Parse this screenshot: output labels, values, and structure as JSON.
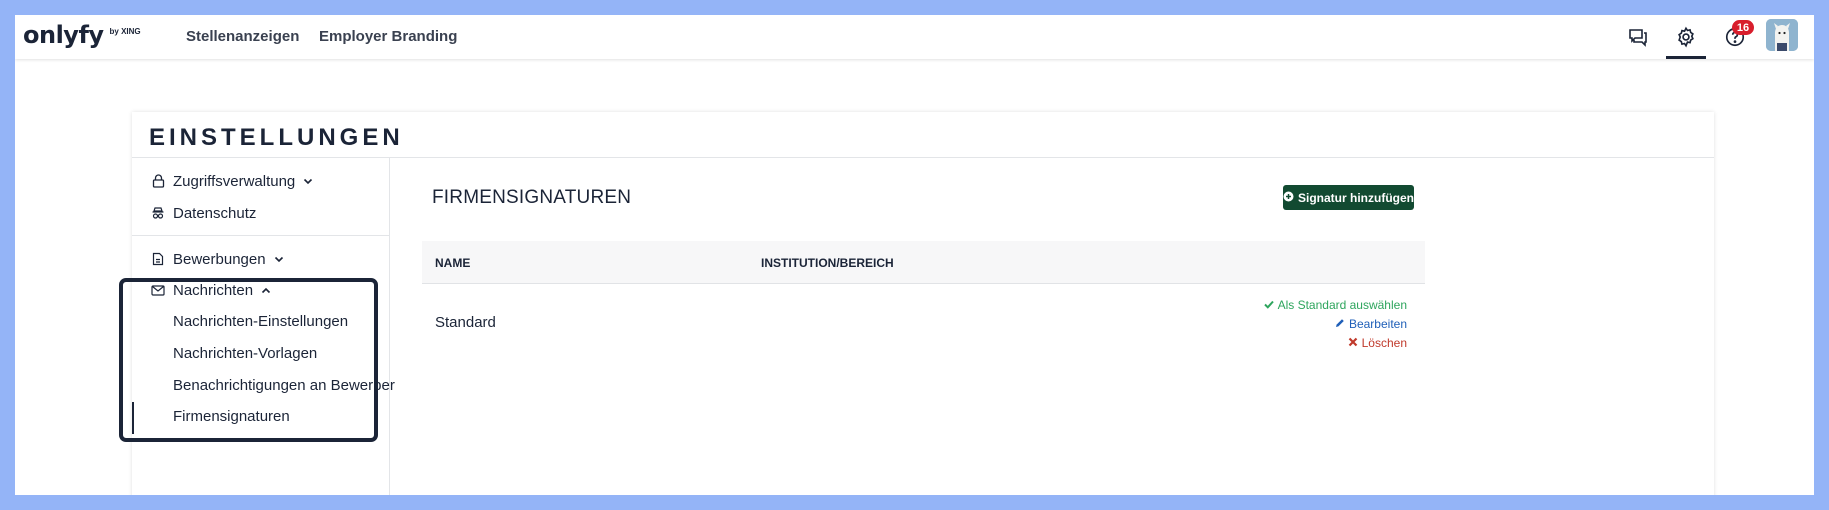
{
  "header": {
    "logo": "onlyfy",
    "logo_suffix": "by XING",
    "nav": [
      "Stellenanzeigen",
      "Employer Branding"
    ],
    "notifications_badge": "16",
    "icons": [
      "chat-icon",
      "gear-icon",
      "help-icon",
      "avatar"
    ]
  },
  "settings": {
    "title": "EINSTELLUNGEN",
    "sidebar": {
      "items": [
        {
          "label": "Zugriffsverwaltung",
          "icon": "lock-icon",
          "expanded": false
        },
        {
          "label": "Datenschutz",
          "icon": "privacy-icon"
        },
        {
          "label": "Bewerbungen",
          "icon": "document-icon",
          "expanded": false
        },
        {
          "label": "Nachrichten",
          "icon": "envelope-icon",
          "expanded": true
        }
      ],
      "sub_items": [
        "Nachrichten-Einstellungen",
        "Nachrichten-Vorlagen",
        "Benachrichtigungen an Bewerber",
        "Firmensignaturen"
      ],
      "active_sub_item": "Firmensignaturen"
    },
    "main": {
      "title": "FIRMENSIGNATUREN",
      "add_button": "Signatur hinzufügen",
      "columns": [
        "NAME",
        "INSTITUTION/BEREICH"
      ],
      "rows": [
        {
          "name": "Standard",
          "institution": "",
          "actions": [
            "Als Standard auswählen",
            "Bearbeiten",
            "Löschen"
          ]
        }
      ]
    }
  },
  "colors": {
    "background_frame": "#94b4f7",
    "primary_dark": "#1b2437",
    "button_green": "#124a31",
    "action_green": "#2ea55d",
    "action_blue": "#1f5fb8",
    "action_red": "#c0392b",
    "badge_red": "#d81e2c"
  }
}
